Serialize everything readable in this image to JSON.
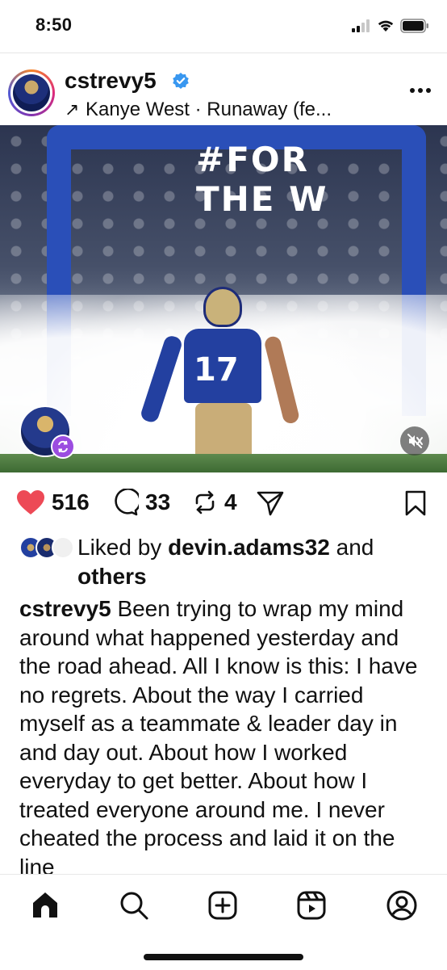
{
  "status_bar": {
    "time": "8:50",
    "icons": [
      "signal-icon",
      "wifi-icon",
      "battery-icon"
    ]
  },
  "post": {
    "username": "cstrevy5",
    "verified": true,
    "audio_label": "Kanye West · Runaway (fe...",
    "more_icon": "more-horizontal-icon",
    "media": {
      "banner_text": "#FOR THE W",
      "jersey_number": "17",
      "collab_badge_icon": "repost-icon",
      "mute_icon": "speaker-muted-icon"
    },
    "actions": {
      "likes": "516",
      "comments": "33",
      "reposts": "4",
      "like_color": "#ed4956"
    },
    "liked_by": {
      "prefix": "Liked by",
      "user": "devin.adams32",
      "suffix_and": "and",
      "suffix_others": "others"
    },
    "caption": {
      "username": "cstrevy5",
      "text": "Been trying to wrap my mind around what happened yesterday and the road ahead. All I know is this: I have no regrets. About the way I carried myself as a teammate & leader day in and day out. About how I worked everyday to get better. About how I treated everyone around me. I never cheated the process and laid it on the line"
    }
  },
  "bottom_nav": {
    "items": [
      "home-icon",
      "search-icon",
      "create-icon",
      "reels-icon",
      "profile-icon"
    ]
  },
  "colors": {
    "accent_verified": "#3897f0",
    "heart": "#ed4956",
    "collab_badge": "#9b4de0"
  }
}
